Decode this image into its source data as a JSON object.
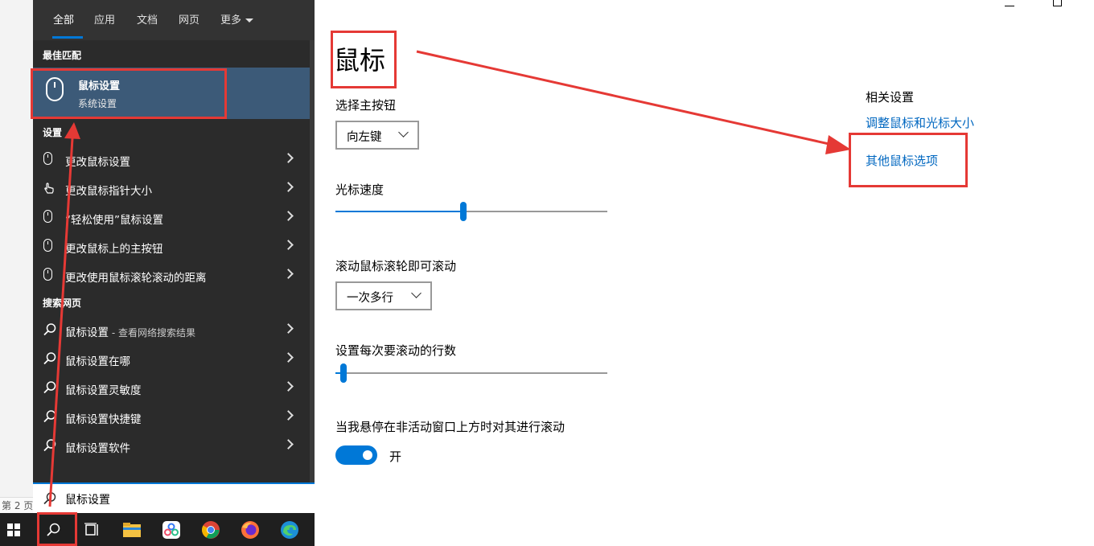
{
  "page_indicator": "第 2 页",
  "search_panel": {
    "tabs": [
      {
        "label": "全部"
      },
      {
        "label": "应用"
      },
      {
        "label": "文档"
      },
      {
        "label": "网页"
      },
      {
        "label": "更多"
      }
    ],
    "best_match_header": "最佳匹配",
    "best_match": {
      "title": "鼠标设置",
      "subtitle": "系统设置"
    },
    "settings_header": "设置",
    "settings_items": [
      {
        "label": "更改鼠标设置"
      },
      {
        "label": "更改鼠标指针大小"
      },
      {
        "label": "“轻松使用”鼠标设置"
      },
      {
        "label": "更改鼠标上的主按钮"
      },
      {
        "label": "更改使用鼠标滚轮滚动的距离"
      }
    ],
    "web_header": "搜索网页",
    "web_items": [
      {
        "label": "鼠标设置",
        "sub": " - 查看网络搜索结果"
      },
      {
        "label": "鼠标设置在哪",
        "sub": ""
      },
      {
        "label": "鼠标设置灵敏度",
        "sub": ""
      },
      {
        "label": "鼠标设置快捷键",
        "sub": ""
      },
      {
        "label": "鼠标设置软件",
        "sub": ""
      }
    ]
  },
  "search": {
    "value": "鼠标设置"
  },
  "settings_page": {
    "title": "鼠标",
    "primary_button_label": "选择主按钮",
    "primary_button_value": "向左键",
    "cursor_speed_label": "光标速度",
    "cursor_speed_fraction": 0.47,
    "scroll_label": "滚动鼠标滚轮即可滚动",
    "scroll_value": "一次多行",
    "lines_label": "设置每次要滚动的行数",
    "lines_fraction": 0.03,
    "inactive_scroll_label": "当我悬停在非活动窗口上方时对其进行滚动",
    "inactive_scroll_state": "开",
    "related_title": "相关设置",
    "related_links": [
      {
        "label": "调整鼠标和光标大小"
      },
      {
        "label": "其他鼠标选项"
      }
    ]
  },
  "colors": {
    "accent": "#0078d7",
    "highlight": "#3c5a78",
    "annotation": "#e53935",
    "link": "#0067c0"
  }
}
